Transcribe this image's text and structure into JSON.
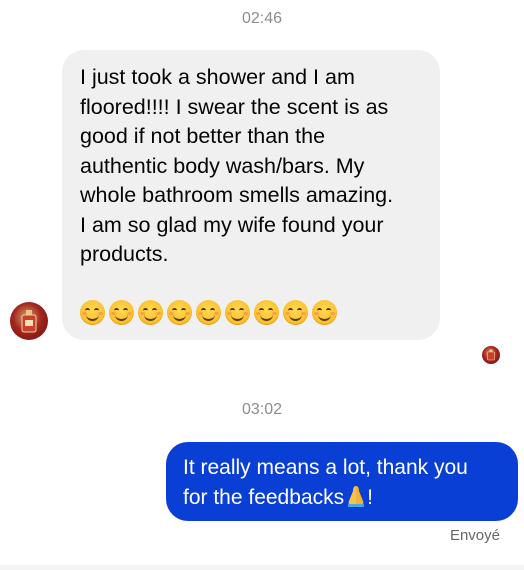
{
  "conversation": {
    "timestamp_1": "02:46",
    "incoming_message": {
      "text": "I just took a shower and I am\nfloored!!!! I swear the scent is as\ngood if not better than the\nauthentic body wash/bars.  My\nwhole bathroom smells amazing.\nI am so glad my wife found your\nproducts.",
      "emoji_icon": "smiling-face-with-smiling-eyes",
      "emoji_count": 9
    },
    "sender_avatar_icon": "perfume-bottle-avatar",
    "timestamp_2": "03:02",
    "outgoing_message": {
      "text": "It really means a lot, thank you\nfor the feedbacks",
      "trailing_emoji": "folded-hands",
      "trailing_text": "!"
    },
    "status": "Envoyé"
  },
  "colors": {
    "incoming_bubble": "#f0f0f0",
    "outgoing_bubble": "#0a3fd6",
    "timestamp_text": "#8a8d91",
    "status_text": "#65676b"
  }
}
